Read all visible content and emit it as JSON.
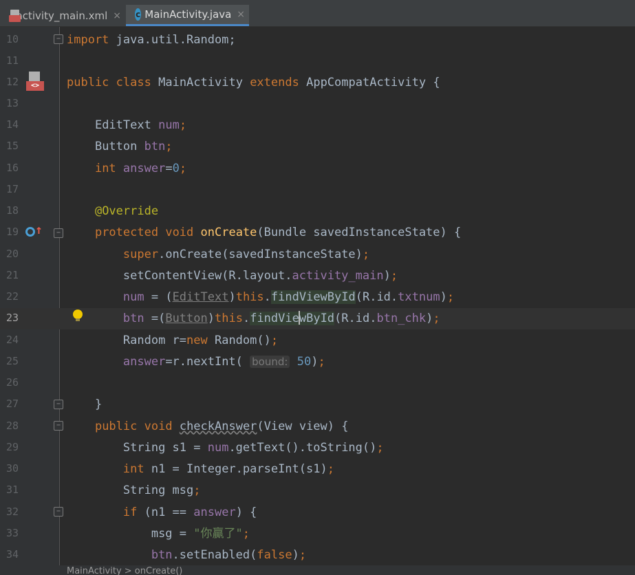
{
  "tabs": [
    {
      "label": "activity_main.xml",
      "close": "×",
      "active": false
    },
    {
      "label": "MainActivity.java",
      "icon_letter": "c",
      "close": "×",
      "active": true
    }
  ],
  "line_numbers": [
    "10",
    "11",
    "12",
    "13",
    "14",
    "15",
    "16",
    "17",
    "18",
    "19",
    "20",
    "21",
    "22",
    "23",
    "24",
    "25",
    "26",
    "27",
    "28",
    "29",
    "30",
    "31",
    "32",
    "33",
    "34"
  ],
  "code": {
    "l10": {
      "import_kw": "import",
      "path": " java.util.Random;"
    },
    "l12": {
      "public": "public",
      "class": "class",
      "name": "MainActivity",
      "extends": "extends",
      "parent": "AppCompatActivity",
      "brace": " {"
    },
    "l14": {
      "type": "EditText",
      "field": "num",
      "semi": ";"
    },
    "l15": {
      "type": "Button",
      "field": "btn",
      "semi": ";"
    },
    "l16": {
      "type": "int",
      "field": "answer",
      "eq": "=",
      "value": "0",
      "semi": ";"
    },
    "l18": {
      "annotation": "@Override"
    },
    "l19": {
      "protected": "protected",
      "void": "void",
      "method": "onCreate",
      "params": "(Bundle savedInstanceState) {"
    },
    "l20": {
      "super": "super",
      "rest": ".onCreate(savedInstanceState)",
      "semi": ";"
    },
    "l21": {
      "call": "setContentView(R.layout.",
      "field": "activity_main",
      "end": ")",
      "semi": ";"
    },
    "l22": {
      "field": "num",
      "mid": " = (",
      "cast": "EditText",
      "close": ")",
      "this": "this",
      "dot": ".",
      "method": "findViewById",
      "args": "(R.id.",
      "id": "txtnum",
      "end": ")",
      "semi": ";"
    },
    "l23": {
      "field": "btn",
      "mid": " =(",
      "cast": "Button",
      "close": ")",
      "this": "this",
      "dot": ".",
      "method_a": "findVie",
      "method_b": "wById",
      "args": "(R.id.",
      "id": "btn_chk",
      "end": ")",
      "semi": ";"
    },
    "l24": {
      "type": "Random r=",
      "new": "new",
      "rest": " Random()",
      "semi": ";"
    },
    "l25": {
      "field": "answer",
      "rest": "=r.nextInt(",
      "hint": "bound:",
      "value": "50",
      "end": ")",
      "semi": ";"
    },
    "l27": {
      "brace": "}"
    },
    "l28": {
      "public": "public",
      "void": "void",
      "method": "checkAnswer",
      "params": "(View view) {"
    },
    "l29": {
      "type": "String s1 = ",
      "field": "num",
      "rest": ".getText().toString()",
      "semi": ";"
    },
    "l30": {
      "int": "int",
      "rest": " n1 = Integer.parseInt(s1)",
      "semi": ";"
    },
    "l31": {
      "type": "String msg",
      "semi": ";"
    },
    "l32": {
      "if": "if",
      "rest": " (n1 == ",
      "field": "answer",
      "end": ") {"
    },
    "l33": {
      "var": "msg = ",
      "string": "\"你贏了\"",
      "semi": ";"
    },
    "l34": {
      "field": "btn",
      "rest": ".setEnabled(",
      "false": "false",
      "end": ")",
      "semi": ";"
    }
  },
  "breadcrumb": "MainActivity  >  onCreate()",
  "colors": {
    "keyword": "#cc7832",
    "field": "#9876aa",
    "number": "#6897bb",
    "string": "#6a8759",
    "annotation": "#bbb529",
    "method": "#ffc66d",
    "default": "#a9b7c6"
  },
  "gutter_icons": [
    "layout-icon",
    "override-icon",
    "fold-marker",
    "lightbulb-icon"
  ]
}
